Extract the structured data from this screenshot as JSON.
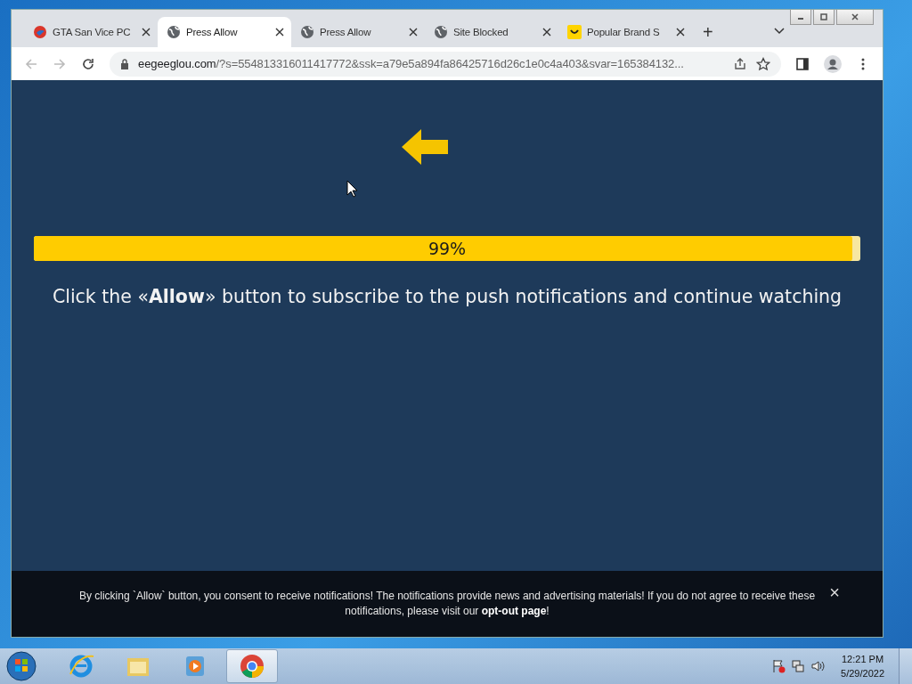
{
  "browser": {
    "tabs": [
      {
        "title": "GTA San Vice PC",
        "kind": "gta",
        "selected": false
      },
      {
        "title": "Press Allow",
        "kind": "globe",
        "selected": true
      },
      {
        "title": "Press Allow",
        "kind": "globe",
        "selected": false
      },
      {
        "title": "Site Blocked",
        "kind": "globe",
        "selected": false
      },
      {
        "title": "Popular Brand S",
        "kind": "smile",
        "selected": false
      }
    ],
    "new_tab": "+",
    "url_host": "eegeeglou.com",
    "url_rest": "/?s=554813316011417772&ssk=a79e5a894fa86425716d26c1e0c4a403&svar=165384132..."
  },
  "page": {
    "progress": {
      "level": 0.99,
      "label": "99%"
    },
    "message": "Click the «**Allow**» button to subscribe to the push notifications and continue watching",
    "notice": {
      "text": "By clicking `Allow` button, you consent to receive notifications! The notifications provide news and advertising materials! If you do not agree to receive these notifications, please visit our ",
      "link": "opt-out page",
      "text_after": "!",
      "close": "×"
    }
  },
  "taskbar": {
    "apps": [
      {
        "kind": "ie",
        "active": false
      },
      {
        "kind": "folder",
        "active": false
      },
      {
        "kind": "media",
        "active": false
      },
      {
        "kind": "chrome",
        "active": true
      }
    ],
    "time": "12:21 PM",
    "date": "5/29/2022"
  }
}
